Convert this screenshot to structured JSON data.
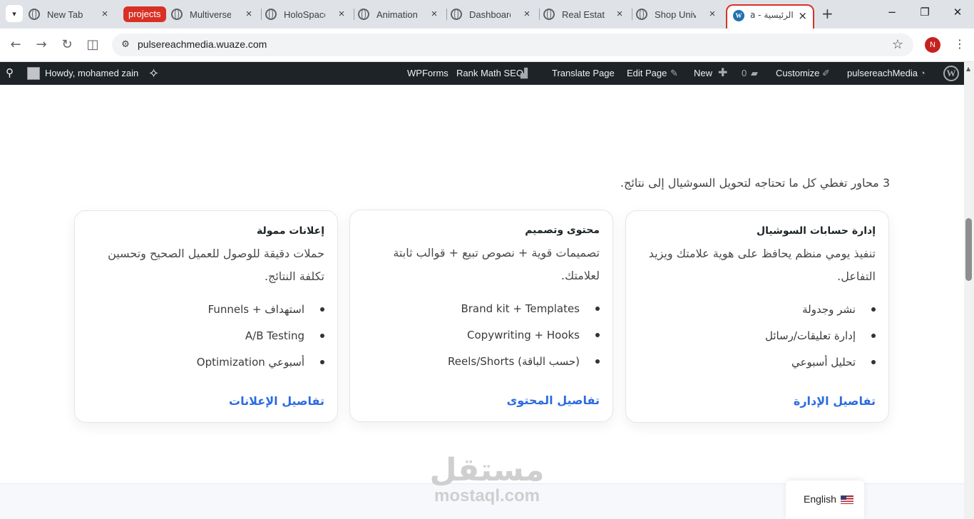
{
  "browser": {
    "tabs": [
      {
        "title": "New Tab"
      },
      {
        "title": "Multiverse"
      },
      {
        "title": "HoloSpace"
      },
      {
        "title": "Animation"
      },
      {
        "title": "Dashboard"
      },
      {
        "title": "Real Estate"
      },
      {
        "title": "Shop Unive"
      }
    ],
    "group_label": "projects",
    "active_tab_title": "الرئيسية - a",
    "url": "pulsereachmedia.wuaze.com",
    "profile_initial": "N"
  },
  "adminbar": {
    "howdy": "Howdy, mohamed zain",
    "wpforms": "WPForms",
    "rankmath": "Rank Math SEO",
    "translate": "Translate Page",
    "edit": "Edit Page",
    "new": "New",
    "comments_count": "0",
    "customize": "Customize",
    "site_name": "pulsereachMedia"
  },
  "page": {
    "intro": "3 محاور تغطي كل ما تحتاجه لتحويل السوشيال إلى نتائج.",
    "cards": [
      {
        "title": "إدارة حسابات السوشيال",
        "desc": "تنفيذ يومي منظم يحافظ على هوية علامتك ويزيد التفاعل.",
        "items": [
          "نشر وجدولة",
          "إدارة تعليقات/رسائل",
          "تحليل أسبوعي"
        ],
        "link": "تفاصيل الإدارة"
      },
      {
        "title": "محتوى وتصميم",
        "desc": "تصميمات قوية + نصوص تبيع + قوالب ثابتة لعلامتك.",
        "items": [
          "Brand kit + Templates",
          "Copywriting + Hooks",
          "Reels/Shorts (حسب الباقة)"
        ],
        "link": "تفاصيل المحتوى"
      },
      {
        "title": "إعلانات ممولة",
        "desc": "حملات دقيقة للوصول للعميل الصحيح وتحسين تكلفة النتائج.",
        "items": [
          "استهداف + Funnels",
          "A/B Testing",
          "Optimization أسبوعي"
        ],
        "link": "تفاصيل الإعلانات"
      }
    ],
    "language_switcher": "English",
    "watermark_ar": "مستقل",
    "watermark_en": "mostaql.com"
  },
  "colors": {
    "accent_link": "#2b6be0",
    "adminbar_bg": "#1d2327",
    "tab_group": "#d93025"
  }
}
